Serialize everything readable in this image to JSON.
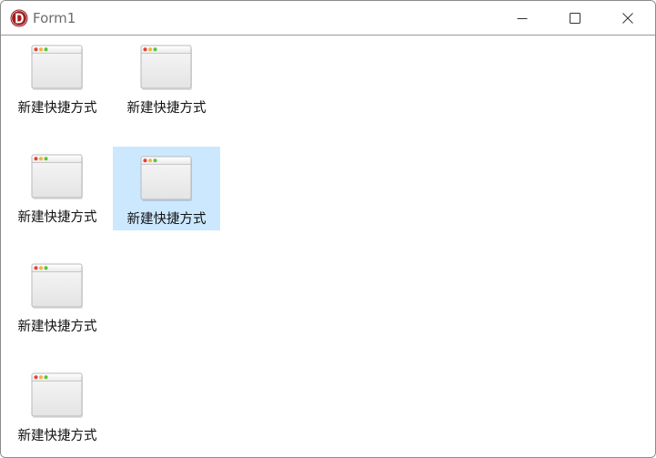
{
  "window": {
    "title": "Form1",
    "app_icon": "delphi-d-icon",
    "controls": {
      "minimize_icon": "minimize-icon",
      "maximize_icon": "maximize-icon",
      "close_icon": "close-icon"
    }
  },
  "colors": {
    "selection": "#cce8ff",
    "title_text": "#6d6d6d",
    "app_icon_bg": "#8b1a1a"
  },
  "items": [
    {
      "label": "新建快捷方式",
      "icon": "window-app-icon",
      "selected": false
    },
    {
      "label": "新建快捷方式",
      "icon": "window-app-icon",
      "selected": false
    },
    {
      "label": "新建快捷方式",
      "icon": "window-app-icon",
      "selected": false
    },
    {
      "label": "新建快捷方式",
      "icon": "window-app-icon",
      "selected": true
    },
    {
      "label": "新建快捷方式",
      "icon": "window-app-icon",
      "selected": false
    },
    {
      "label": "新建快捷方式",
      "icon": "window-app-icon",
      "selected": false
    }
  ]
}
